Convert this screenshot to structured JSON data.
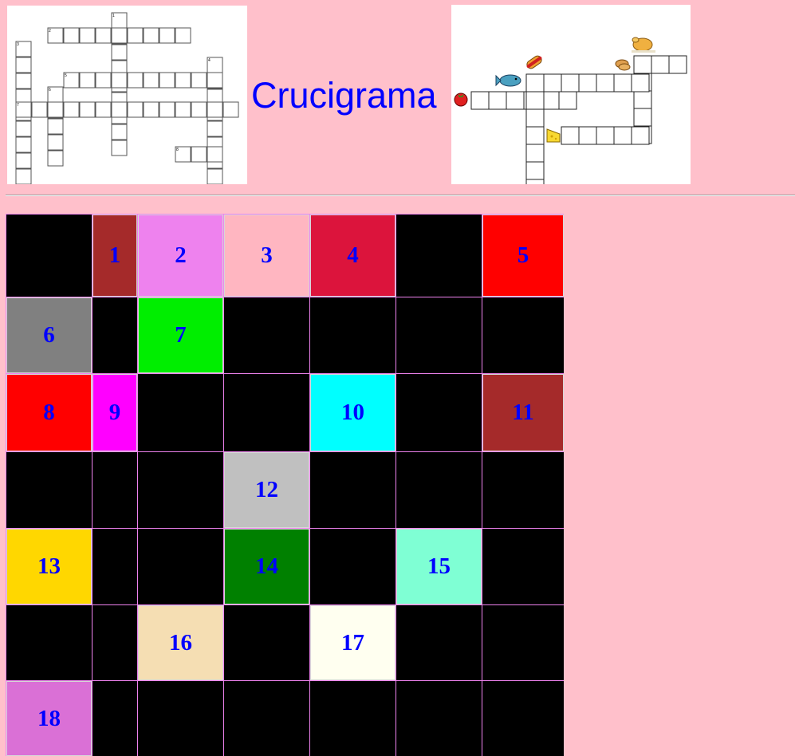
{
  "header": {
    "title": "Crucigrama"
  },
  "left_crossword": {
    "clue_numbers": [
      "1",
      "2",
      "3",
      "4",
      "5",
      "6",
      "7",
      "8"
    ]
  },
  "right_crossword": {
    "icons": [
      "chicken-icon",
      "hotdog-icon",
      "bread-icon",
      "fish-icon",
      "tomato-icon",
      "cheese-icon"
    ]
  },
  "grid": {
    "rows": [
      [
        {
          "n": "",
          "c": "#000000"
        },
        {
          "n": "1",
          "c": "#a52a2a"
        },
        {
          "n": "2",
          "c": "#ee82ee"
        },
        {
          "n": "3",
          "c": "#ffb6c1"
        },
        {
          "n": "4",
          "c": "#dc143c"
        },
        {
          "n": "",
          "c": "#000000"
        },
        {
          "n": "5",
          "c": "#ff0000"
        }
      ],
      [
        {
          "n": "6",
          "c": "#808080"
        },
        {
          "n": "",
          "c": "#000000"
        },
        {
          "n": "7",
          "c": "#00ee00"
        },
        {
          "n": "",
          "c": "#000000"
        },
        {
          "n": "",
          "c": "#000000"
        },
        {
          "n": "",
          "c": "#000000"
        },
        {
          "n": "",
          "c": "#000000"
        }
      ],
      [
        {
          "n": "8",
          "c": "#ff0000"
        },
        {
          "n": "9",
          "c": "#ff00ff"
        },
        {
          "n": "",
          "c": "#000000"
        },
        {
          "n": "",
          "c": "#000000"
        },
        {
          "n": "10",
          "c": "#00ffff"
        },
        {
          "n": "",
          "c": "#000000"
        },
        {
          "n": "11",
          "c": "#a52a2a"
        }
      ],
      [
        {
          "n": "",
          "c": "#000000"
        },
        {
          "n": "",
          "c": "#000000"
        },
        {
          "n": "",
          "c": "#000000"
        },
        {
          "n": "12",
          "c": "#c0c0c0"
        },
        {
          "n": "",
          "c": "#000000"
        },
        {
          "n": "",
          "c": "#000000"
        },
        {
          "n": "",
          "c": "#000000"
        }
      ],
      [
        {
          "n": "13",
          "c": "#ffd700"
        },
        {
          "n": "",
          "c": "#000000"
        },
        {
          "n": "",
          "c": "#000000"
        },
        {
          "n": "14",
          "c": "#008000"
        },
        {
          "n": "",
          "c": "#000000"
        },
        {
          "n": "15",
          "c": "#7fffd4"
        },
        {
          "n": "",
          "c": "#000000"
        }
      ],
      [
        {
          "n": "",
          "c": "#000000"
        },
        {
          "n": "",
          "c": "#000000"
        },
        {
          "n": "16",
          "c": "#f5deb3"
        },
        {
          "n": "",
          "c": "#000000"
        },
        {
          "n": "17",
          "c": "#fffff0"
        },
        {
          "n": "",
          "c": "#000000"
        },
        {
          "n": "",
          "c": "#000000"
        }
      ],
      [
        {
          "n": "18",
          "c": "#da70d6"
        },
        {
          "n": "",
          "c": "#000000"
        },
        {
          "n": "",
          "c": "#000000"
        },
        {
          "n": "",
          "c": "#000000"
        },
        {
          "n": "",
          "c": "#000000"
        },
        {
          "n": "",
          "c": "#000000"
        },
        {
          "n": "",
          "c": "#000000"
        }
      ]
    ]
  }
}
